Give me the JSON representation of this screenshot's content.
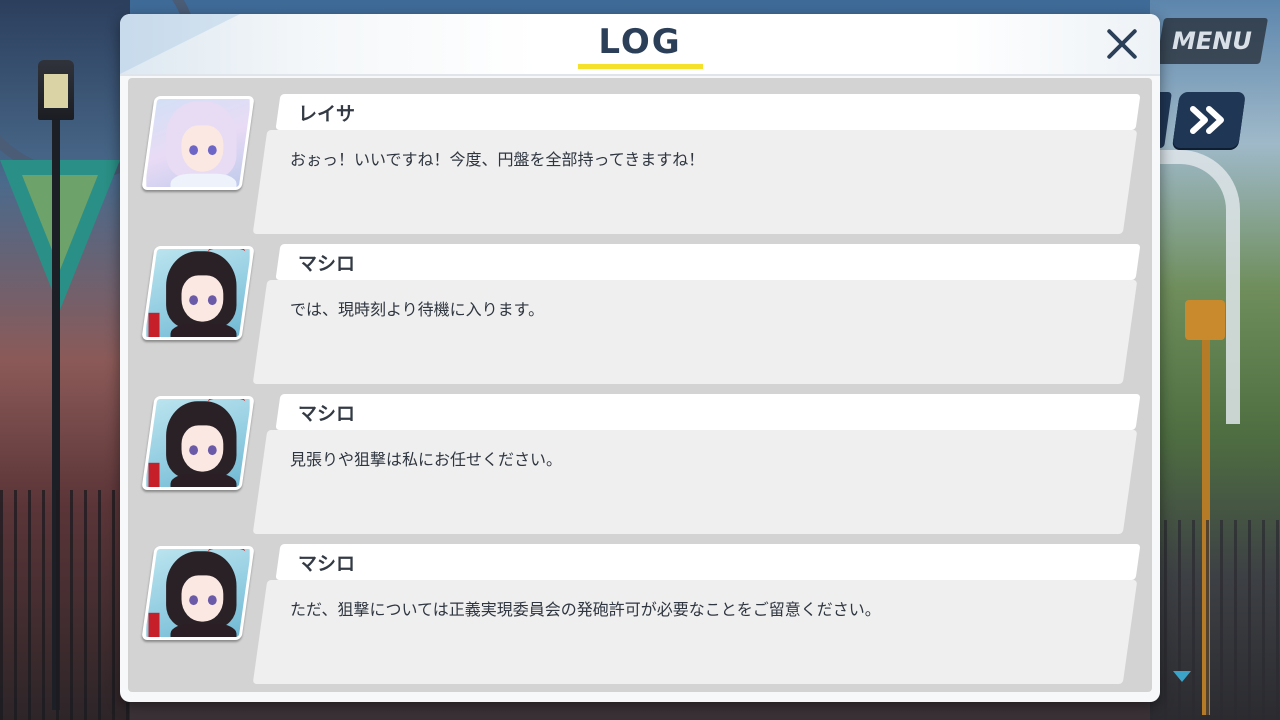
{
  "log_window": {
    "title": "LOG"
  },
  "hud": {
    "menu_label": "MENU"
  },
  "entries": [
    {
      "speaker": "レイサ",
      "text": "おぉっ！いいですね！今度、円盤を全部持ってきますね！",
      "avatar": "reisa-portrait"
    },
    {
      "speaker": "マシロ",
      "text": "では、現時刻より待機に入ります。",
      "avatar": "mashiro-portrait"
    },
    {
      "speaker": "マシロ",
      "text": "見張りや狙撃は私にお任せください。",
      "avatar": "mashiro-portrait"
    },
    {
      "speaker": "マシロ",
      "text": "ただ、狙撃については正義実現委員会の発砲許可が必要なことをご留意ください。",
      "avatar": "mashiro-portrait"
    }
  ],
  "colors": {
    "title": "#2b3f59",
    "title_underline": "#f5e02a",
    "bubble": "#efefef",
    "log_bg": "#d3d3d3",
    "ff_button": "#1f3654",
    "scroll_arrow": "#3ba3c7"
  },
  "icons": {
    "close": "close-icon",
    "fast_forward": "fast-forward-icon",
    "scroll_down": "scroll-down-icon"
  }
}
